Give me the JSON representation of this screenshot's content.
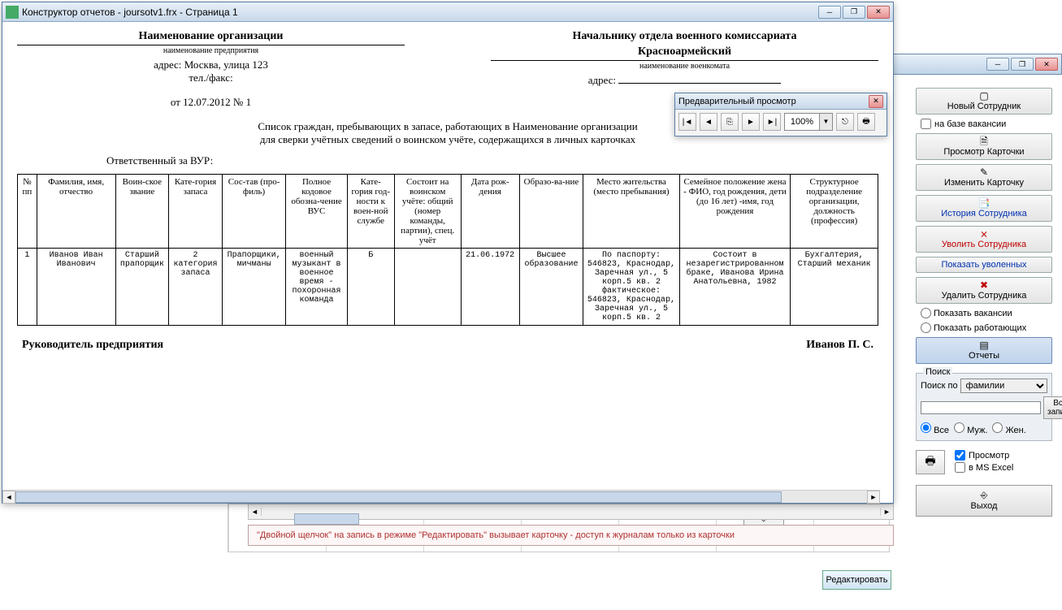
{
  "parent_window": {
    "min": "_",
    "max": "❐",
    "close": "✕"
  },
  "report_window": {
    "title": "Конструктор отчетов - joursotv1.frx - Страница 1",
    "org_title": "Наименование организации",
    "org_sub": "наименование предприятия",
    "org_addr_label": "адрес:",
    "org_addr": "Москва, улица 123",
    "tel_label": "тел./факс:",
    "date_line": "от 12.07.2012   № 1",
    "recipient_title": "Начальнику отдела военного комиссариата",
    "recipient_name": "Красноармейский",
    "recipient_sub": "наименование военкомата",
    "recipient_addr_label": "адрес:",
    "list_title_1": "Список граждан, пребывающих в запасе, работающих в Наименование организации",
    "list_title_2": "для сверки учётных сведений о воинском учёте, содержащихся в личных карточках",
    "responsible": "Ответственный за ВУР:",
    "footer_left": "Руководитель предприятия",
    "footer_right": "Иванов П. С."
  },
  "table": {
    "headers": [
      "№ пп",
      "Фамилия, имя, отчество",
      "Воин-ское звание",
      "Кате-гория запаса",
      "Сос-тав (про-филь)",
      "Полное кодовое обозна-чение ВУС",
      "Кате-гория год-ности к воен-ной службе",
      "Состоит на воинском учёте: общий (номер команды, партии), спец. учёт",
      "Дата рож-дения",
      "Образо-ва-ние",
      "Место жительства (место пребывания)",
      "Семейное положение жена - ФИО, год рождения, дети (до 16 лет) -имя, год рождения",
      "Структурное подразделение организации, должность (профессия)"
    ],
    "rows": [
      [
        "1",
        "Иванов Иван Иванович",
        "Старший прапорщик",
        "2 категория запаса",
        "Прапорщики, мичманы",
        "военный музыкант в военное время - похоронная команда",
        "Б",
        "",
        "21.06.1972",
        "Высшее образование",
        "По паспорту: 546823, Краснодар, Заречная ул., 5 корп.5 кв. 2 фактическое: 546823, Краснодар, Заречная ул., 5 корп.5 кв. 2",
        "Состоит в незарегистрированном браке, Иванова Ирина Анатольевна, 1982",
        "Бухгалтерия, Старший механик"
      ]
    ]
  },
  "preview": {
    "title": "Предварительный просмотр",
    "zoom": "100%"
  },
  "side": {
    "new_emp": "Новый Сотрудник",
    "based_vacancy": "на базе вакансии",
    "view_card": "Просмотр Карточки",
    "edit_card": "Изменить Карточку",
    "history": "История Сотрудника",
    "fire": "Уволить Сотрудника",
    "show_fired": "Показать уволенных",
    "delete_emp": "Удалить Сотрудника",
    "show_vac": "Показать вакансии",
    "show_work": "Показать работающих",
    "reports": "Отчеты",
    "search_legend": "Поиск",
    "search_by": "Поиск по",
    "search_field": "фамилии",
    "all_rec": "Все записи",
    "all": "Все",
    "m": "Муж.",
    "f": "Жен.",
    "preview_chk": "Просмотр",
    "excel_chk": "в MS Excel",
    "exit": "Выход"
  },
  "lower": {
    "hint": "\"Двойной щелчок\" на запись в режиме \"Редактировать\" вызывает карточку  -  доступ к журналам только из карточки",
    "edit": "Редактировать",
    "exit": "Выход"
  }
}
